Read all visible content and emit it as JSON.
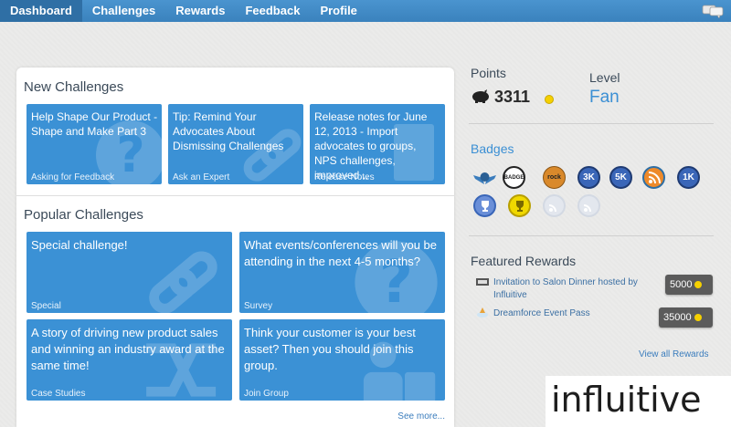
{
  "nav": {
    "items": [
      "Dashboard",
      "Challenges",
      "Rewards",
      "Feedback",
      "Profile"
    ],
    "active": "Dashboard"
  },
  "new_challenges": {
    "title": "New Challenges",
    "cards": [
      {
        "title": "Help Shape Our Product - Shape and Make Part 3",
        "category": "Asking for Feedback"
      },
      {
        "title": "Tip: Remind Your Advocates About Dismissing Challenges",
        "category": "Ask an Expert"
      },
      {
        "title": "Release notes for June 12, 2013 - Import advocates to groups, NPS challenges, improved...",
        "category": "Release Notes"
      }
    ]
  },
  "popular_challenges": {
    "title": "Popular Challenges",
    "cards": [
      {
        "title": "Special challenge!",
        "category": "Special"
      },
      {
        "title": "What events/conferences will you be attending in the next 4-5 months?",
        "category": "Survey"
      },
      {
        "title": "A story of driving new product sales and winning an industry award at the same time!",
        "category": "Case Studies"
      },
      {
        "title": "Think your customer is your best asset? Then you should join this group.",
        "category": "Join Group"
      }
    ],
    "see_more": "See more..."
  },
  "points": {
    "label": "Points",
    "value": "3311"
  },
  "level": {
    "label": "Level",
    "value": "Fan"
  },
  "badges": {
    "title": "Badges",
    "row1": [
      {
        "icon": "wings-icon",
        "text": ""
      },
      {
        "icon": "badge-awarded-icon",
        "text": ""
      },
      {
        "icon": "rock-star-icon",
        "text": ""
      },
      {
        "icon": "3k-badge",
        "text": "3K"
      },
      {
        "icon": "5k-badge",
        "text": "5K"
      },
      {
        "icon": "social-fan-icon",
        "text": ""
      },
      {
        "icon": "1k-badge",
        "text": "1K"
      }
    ],
    "row2": [
      {
        "icon": "trophy-icon",
        "text": ""
      },
      {
        "icon": "trophy-gold-icon",
        "text": ""
      },
      {
        "icon": "rss-faded-icon",
        "text": ""
      },
      {
        "icon": "rss-faded-icon",
        "text": ""
      },
      {
        "icon": "blank-badge",
        "text": ""
      }
    ]
  },
  "featured_rewards": {
    "title": "Featured Rewards",
    "items": [
      {
        "name": "Invitation to Salon Dinner hosted by Influitive",
        "cost": "5000"
      },
      {
        "name": "Dreamforce Event Pass",
        "cost": "35000"
      }
    ],
    "view_all": "View all Rewards"
  },
  "logo": {
    "text": "influitive"
  },
  "colors": {
    "nav": "#3a82bd",
    "card": "#3b91d5",
    "accent": "#3b8fd4",
    "coin": "#f5d000"
  }
}
